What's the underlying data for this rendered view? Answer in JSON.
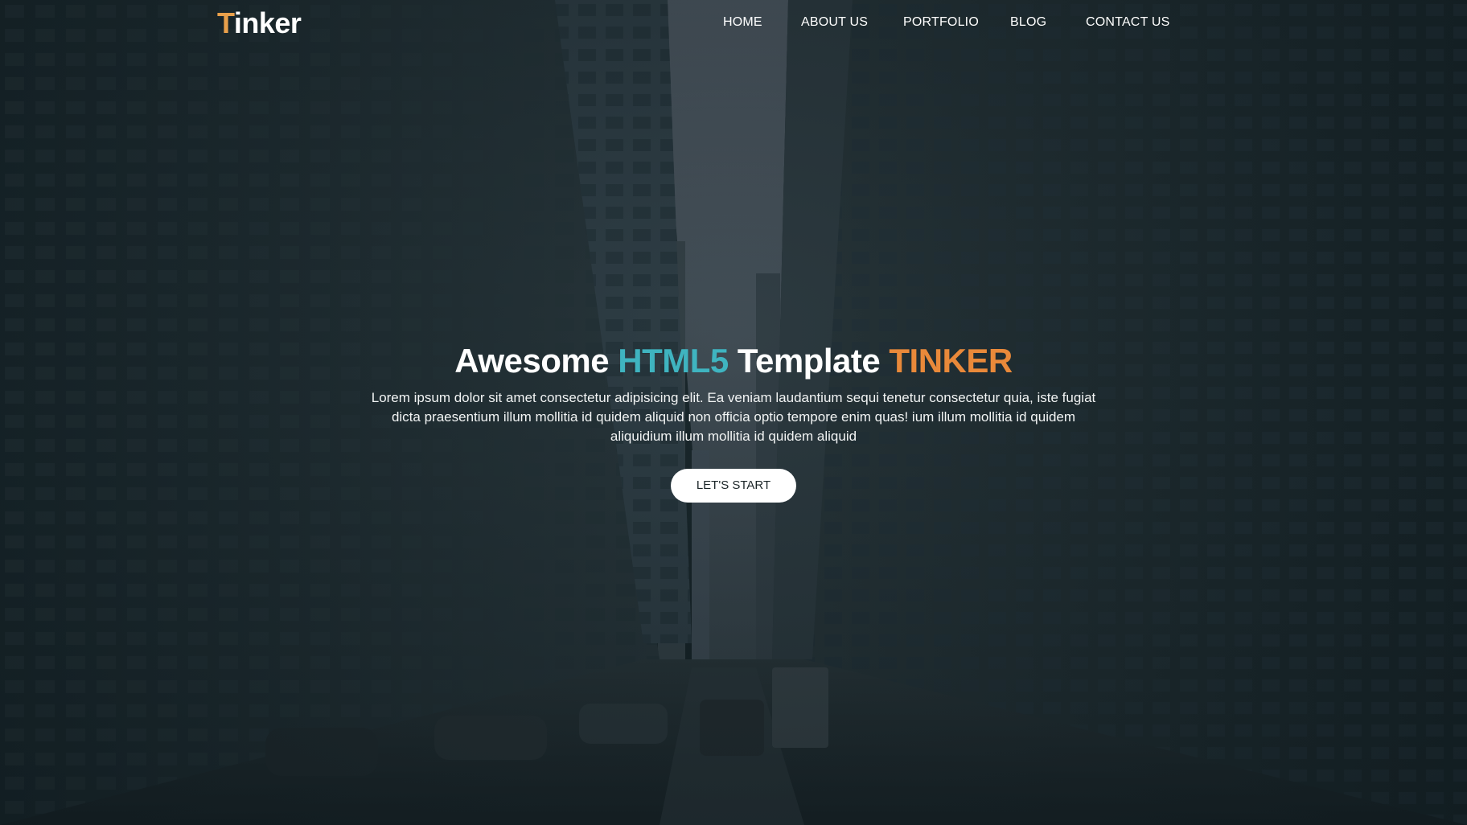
{
  "brand": {
    "first_letter": "T",
    "rest": "inker",
    "first_letter_color": "#e9a04b"
  },
  "nav": {
    "items": [
      {
        "label": "HOME"
      },
      {
        "label": "ABOUT US"
      },
      {
        "label": "PORTFOLIO"
      },
      {
        "label": "BLOG"
      },
      {
        "label": "CONTACT US"
      }
    ]
  },
  "hero": {
    "headline_part1": "Awesome ",
    "headline_accent1": "HTML5",
    "headline_part2": " Template ",
    "headline_accent2": "TINKER",
    "accent1_color": "#3fb4c0",
    "accent2_color": "#e9893a",
    "lead": "Lorem ipsum dolor sit amet consectetur adipisicing elit. Ea veniam laudantium sequi tenetur consectetur quia, iste fugiat dicta praesentium illum mollitia id quidem aliquid non officia optio tempore enim quas! ium illum mollitia id quidem aliquidium illum mollitia id quidem aliquid",
    "cta_label": "LET'S START"
  }
}
